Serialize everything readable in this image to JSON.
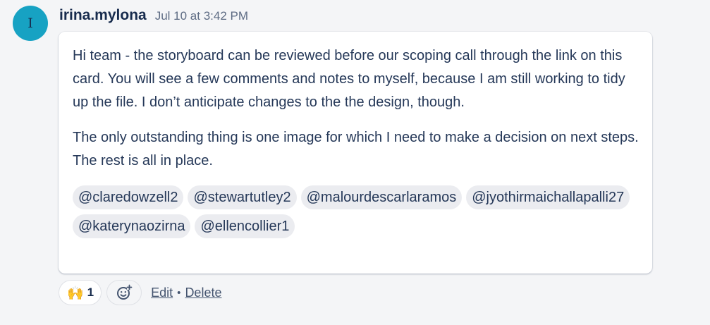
{
  "comment": {
    "avatar_initial": "I",
    "avatar_color": "#17a2c3",
    "author": "irina.mylona",
    "timestamp": "Jul 10 at 3:42 PM",
    "paragraphs": [
      "Hi team - the storyboard can be reviewed before our scoping call through the link on this card. You will see a few comments and notes to myself, because I am still working to tidy up the file. I don’t anticipate changes to the the design, though.",
      "The only outstanding thing is one image for which I need to make a decision on next steps. The rest is all in place."
    ],
    "mentions": [
      "@claredowzell2",
      "@stewartutley2",
      "@malourdescarlaramos",
      "@jyothirmaichallapalli27",
      "@katerynaozirna",
      "@ellencollier1"
    ]
  },
  "footer": {
    "reaction": {
      "icon": "raising-hands-icon",
      "emoji": "🙌",
      "count": "1"
    },
    "add_reaction_icon": "add-emoji-icon",
    "edit_label": "Edit",
    "separator": "•",
    "delete_label": "Delete"
  }
}
